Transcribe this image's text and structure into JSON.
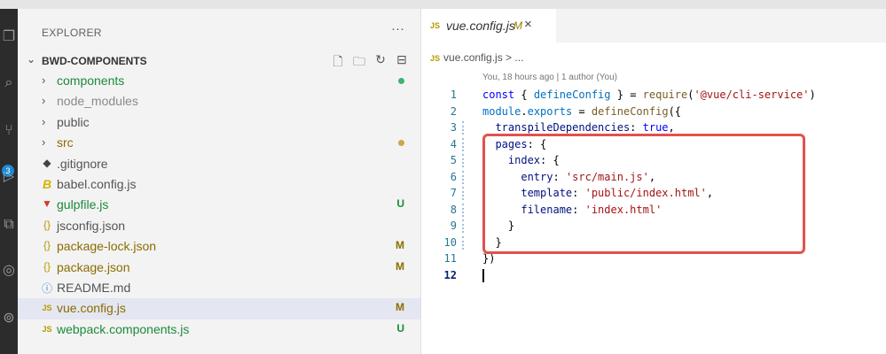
{
  "activity_bar": {
    "badge": "3"
  },
  "explorer": {
    "title": "EXPLORER",
    "more": "···",
    "project": "BWD-COMPONENTS",
    "items": [
      {
        "type": "folder",
        "label": "components",
        "color": "#1b8a3a",
        "status": "",
        "dot": "#3cb371"
      },
      {
        "type": "folder",
        "label": "node_modules",
        "color": "#8a8a8a",
        "status": "",
        "dot": ""
      },
      {
        "type": "folder",
        "label": "public",
        "color": "#555555",
        "status": "",
        "dot": ""
      },
      {
        "type": "folder",
        "label": "src",
        "color": "#8a6d00",
        "status": "",
        "dot": "#c9a84a"
      },
      {
        "type": "file",
        "icon": "◆",
        "icon_name": "git-diamond-icon",
        "icon_color": "#444444",
        "label": ".gitignore",
        "color": "#555555",
        "status": ""
      },
      {
        "type": "file",
        "icon": "B",
        "icon_name": "babel-icon",
        "icon_color": "#d4b400",
        "label": "babel.config.js",
        "color": "#555555",
        "status": ""
      },
      {
        "type": "file",
        "icon": "▼",
        "icon_name": "gulp-icon",
        "icon_color": "#d23a2a",
        "label": "gulpfile.js",
        "color": "#1b8a3a",
        "status": "U"
      },
      {
        "type": "file",
        "icon": "{}",
        "icon_name": "json-braces-icon",
        "icon_color": "#b59a00",
        "label": "jsconfig.json",
        "color": "#555555",
        "status": ""
      },
      {
        "type": "file",
        "icon": "{}",
        "icon_name": "json-braces-icon",
        "icon_color": "#b59a00",
        "label": "package-lock.json",
        "color": "#8a6d00",
        "status": "M"
      },
      {
        "type": "file",
        "icon": "{}",
        "icon_name": "json-braces-icon",
        "icon_color": "#b59a00",
        "label": "package.json",
        "color": "#8a6d00",
        "status": "M"
      },
      {
        "type": "file",
        "icon": "ⓘ",
        "icon_name": "info-icon",
        "icon_color": "#3a7bd5",
        "label": "README.md",
        "color": "#555555",
        "status": ""
      },
      {
        "type": "file",
        "icon": "JS",
        "icon_name": "js-icon",
        "icon_color": "#b59a00",
        "label": "vue.config.js",
        "color": "#8a6d00",
        "status": "M",
        "selected": true
      },
      {
        "type": "file",
        "icon": "JS",
        "icon_name": "js-icon",
        "icon_color": "#b59a00",
        "label": "webpack.components.js",
        "color": "#1b8a3a",
        "status": "U"
      }
    ]
  },
  "tab": {
    "icon": "JS",
    "title": "vue.config.js",
    "modified": "M",
    "close": "×"
  },
  "breadcrumb": {
    "icon": "JS",
    "path": "vue.config.js > ..."
  },
  "blame": "You, 18 hours ago | 1 author (You)",
  "code_lines": [
    {
      "n": "1",
      "tokens": [
        [
          "k",
          "const"
        ],
        [
          "x",
          " { "
        ],
        [
          "v",
          "defineConfig"
        ],
        [
          "x",
          " } = "
        ],
        [
          "f",
          "require"
        ],
        [
          "x",
          "("
        ],
        [
          "s",
          "'@vue/cli-service'"
        ],
        [
          "x",
          ")"
        ]
      ]
    },
    {
      "n": "2",
      "tokens": [
        [
          "v",
          "module"
        ],
        [
          "x",
          "."
        ],
        [
          "v",
          "exports"
        ],
        [
          "x",
          " = "
        ],
        [
          "f",
          "defineConfig"
        ],
        [
          "x",
          "({"
        ]
      ]
    },
    {
      "n": "3",
      "mark": true,
      "tokens": [
        [
          "x",
          "  "
        ],
        [
          "p",
          "transpileDependencies"
        ],
        [
          "x",
          ": "
        ],
        [
          "c",
          "true"
        ],
        [
          "x",
          ","
        ]
      ]
    },
    {
      "n": "4",
      "mark": true,
      "tokens": [
        [
          "x",
          "  "
        ],
        [
          "p",
          "pages"
        ],
        [
          "x",
          ": {"
        ]
      ]
    },
    {
      "n": "5",
      "mark": true,
      "tokens": [
        [
          "x",
          "    "
        ],
        [
          "p",
          "index"
        ],
        [
          "x",
          ": {"
        ]
      ]
    },
    {
      "n": "6",
      "mark": true,
      "tokens": [
        [
          "x",
          "      "
        ],
        [
          "p",
          "entry"
        ],
        [
          "x",
          ": "
        ],
        [
          "s",
          "'src/main.js'"
        ],
        [
          "x",
          ","
        ]
      ]
    },
    {
      "n": "7",
      "mark": true,
      "tokens": [
        [
          "x",
          "      "
        ],
        [
          "p",
          "template"
        ],
        [
          "x",
          ": "
        ],
        [
          "s",
          "'public/index.html'"
        ],
        [
          "x",
          ","
        ]
      ]
    },
    {
      "n": "8",
      "mark": true,
      "tokens": [
        [
          "x",
          "      "
        ],
        [
          "p",
          "filename"
        ],
        [
          "x",
          ": "
        ],
        [
          "s",
          "'index.html'"
        ]
      ]
    },
    {
      "n": "9",
      "mark": true,
      "tokens": [
        [
          "x",
          "    }"
        ]
      ]
    },
    {
      "n": "10",
      "mark": true,
      "tokens": [
        [
          "x",
          "  }"
        ]
      ]
    },
    {
      "n": "11",
      "tokens": [
        [
          "x",
          "})"
        ]
      ]
    },
    {
      "n": "12",
      "current": true,
      "tokens": []
    }
  ],
  "colors": {
    "highlight_box": "#e0524f",
    "selection": "#e4e6f1",
    "modified": "#8a6d00",
    "untracked": "#1b8a3a"
  }
}
